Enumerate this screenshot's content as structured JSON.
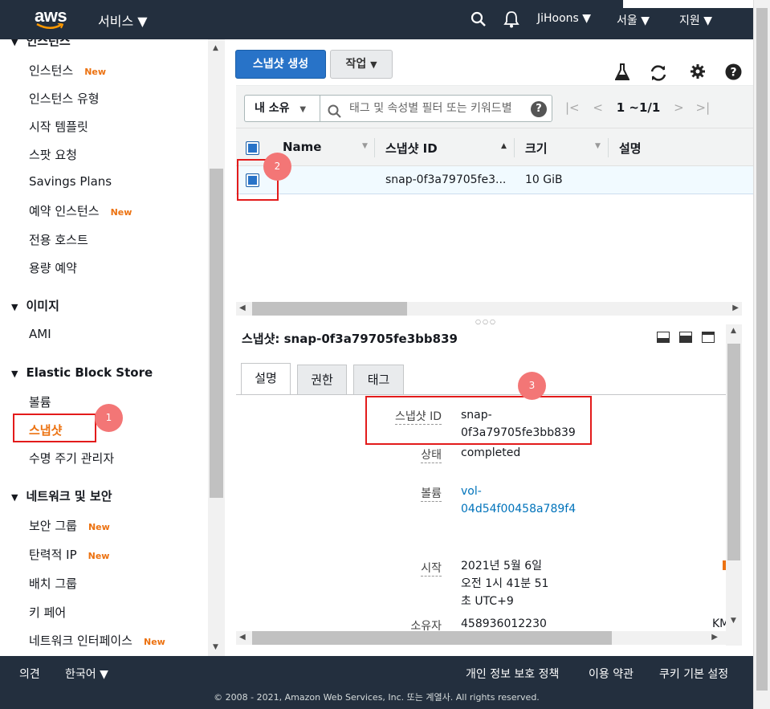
{
  "header": {
    "logo": "aws",
    "services": "서비스 ▼",
    "user": "JiHoons ▼",
    "region": "서울 ▼",
    "support": "지원 ▼"
  },
  "sidebar": {
    "cut_item": "인스턴스",
    "items": [
      {
        "label": "인스턴스",
        "badge": "New"
      },
      {
        "label": "인스턴스 유형",
        "badge": ""
      },
      {
        "label": "시작 템플릿",
        "badge": ""
      },
      {
        "label": "스팟 요청",
        "badge": ""
      },
      {
        "label": "Savings Plans",
        "badge": ""
      },
      {
        "label": "예약 인스턴스",
        "badge": "New"
      },
      {
        "label": "전용 호스트",
        "badge": ""
      },
      {
        "label": "용량 예약",
        "badge": ""
      }
    ],
    "section_images": "이미지",
    "ami": "AMI",
    "section_ebs": "Elastic Block Store",
    "ebs_items": [
      "볼륨",
      "스냅샷",
      "수명 주기 관리자"
    ],
    "section_network": "네트워크 및 보안",
    "net_items": [
      {
        "label": "보안 그룹",
        "badge": "New"
      },
      {
        "label": "탄력적 IP",
        "badge": "New"
      },
      {
        "label": "배치 그룹",
        "badge": ""
      },
      {
        "label": "키 페어",
        "badge": ""
      },
      {
        "label": "네트워크 인터페이스",
        "badge": "New"
      }
    ]
  },
  "toolbar": {
    "create_snapshot": "스냅샷 생성",
    "actions": "작업"
  },
  "filter": {
    "owner": "내 소유",
    "placeholder": "태그 및 속성별 필터 또는 키워드별",
    "pagination": "1 ~1/1"
  },
  "table": {
    "headers": [
      "Name",
      "스냅샷 ID",
      "크기",
      "설명"
    ],
    "rows": [
      {
        "name": "",
        "snapshot_id": "snap-0f3a79705fe3...",
        "size": "10 GiB",
        "description": ""
      }
    ]
  },
  "detail": {
    "title": "스냅샷: snap-0f3a79705fe3bb839",
    "tabs": [
      "설명",
      "권한",
      "태그"
    ],
    "fields": {
      "snapshot_id_label": "스냅샷 ID",
      "snapshot_id_1": "snap-",
      "snapshot_id_2": "0f3a79705fe3bb839",
      "status_label": "상태",
      "status": "completed",
      "volume_label": "볼륨",
      "volume_1": "vol-",
      "volume_2": "04d54f00458a789f4",
      "started_label": "시작",
      "started_1": "2021년 5월 6일",
      "started_2": "오전 1시 41분 51",
      "started_3": "초 UTC+9",
      "owner_label": "소유자",
      "owner": "458936012230",
      "cut_right": "KM"
    }
  },
  "markers": [
    "1",
    "2",
    "3"
  ],
  "footer": {
    "feedback": "의견",
    "language": "한국어 ▼",
    "privacy": "개인 정보 보호 정책",
    "terms": "이용 약관",
    "cookies": "쿠키 기본 설정",
    "copyright": "© 2008 - 2021, Amazon Web Services, Inc. 또는 계열사. All rights reserved."
  }
}
